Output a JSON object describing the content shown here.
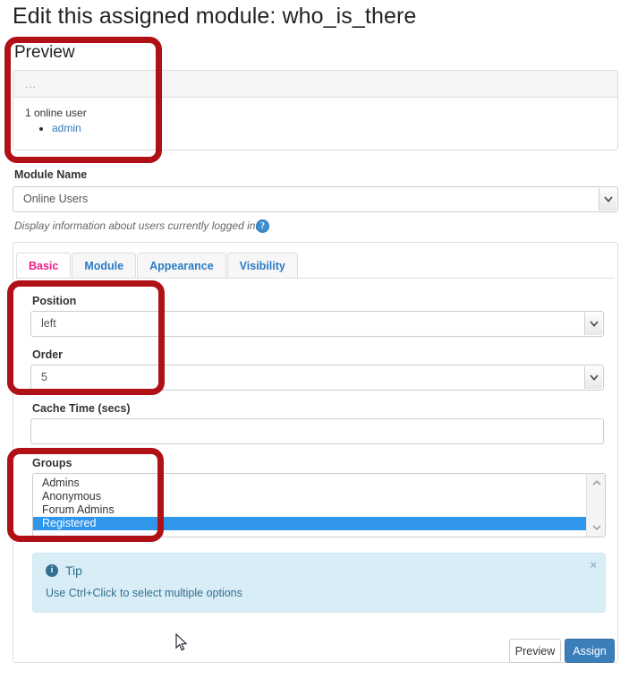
{
  "page": {
    "title": "Edit this assigned module: who_is_there"
  },
  "preview": {
    "label": "Preview",
    "header_text": "...",
    "count_text": "1 online user",
    "users": [
      "admin"
    ]
  },
  "module_name": {
    "label": "Module Name",
    "selected": "Online Users",
    "help_text": "Display information about users currently logged in.",
    "help_icon": "question-circle-icon"
  },
  "tabs": [
    {
      "label": "Basic",
      "active": true
    },
    {
      "label": "Module",
      "active": false
    },
    {
      "label": "Appearance",
      "active": false
    },
    {
      "label": "Visibility",
      "active": false
    }
  ],
  "fields": {
    "position": {
      "label": "Position",
      "value": "left"
    },
    "order": {
      "label": "Order",
      "value": "5"
    },
    "cache": {
      "label": "Cache Time (secs)",
      "value": "",
      "placeholder": ""
    }
  },
  "groups": {
    "label": "Groups",
    "options": [
      "Admins",
      "Anonymous",
      "Forum Admins",
      "Registered"
    ],
    "selected": [
      "Registered"
    ]
  },
  "tip": {
    "icon": "info-circle-icon",
    "title": "Tip",
    "text": "Use Ctrl+Click to select multiple options",
    "close_label": "×"
  },
  "buttons": {
    "preview": "Preview",
    "assign": "Assign"
  },
  "colors": {
    "active_tab": "#f01e8c",
    "tab_link": "#2b7bc4",
    "primary_button": "#3b7fba",
    "selection": "#2f96eb",
    "annotation": "#b01116",
    "link": "#337ab7",
    "tip_bg": "#d9edf7",
    "tip_text": "#31708f"
  }
}
